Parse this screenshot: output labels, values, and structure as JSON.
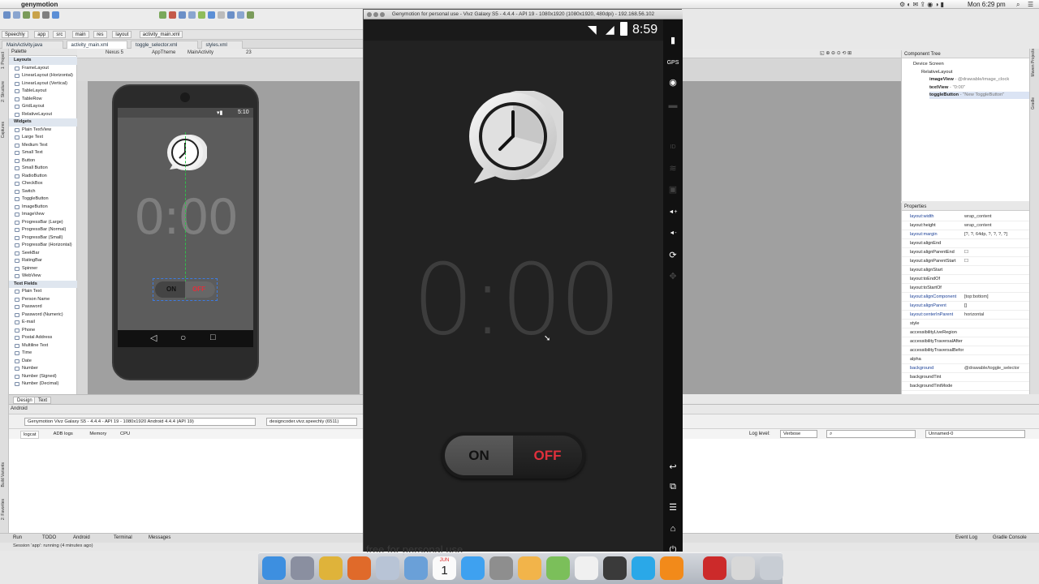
{
  "menubar": {
    "app_name": "genymotion",
    "clock": "Mon 6:29 pm"
  },
  "ide": {
    "crumbs": [
      "Speechly",
      "app",
      "src",
      "main",
      "res",
      "layout",
      "activity_main.xml"
    ],
    "tabs": [
      "MainActivity.java",
      "activity_main.xml",
      "toggle_selector.xml",
      "styles.xml"
    ],
    "design_toolbar": {
      "device": "Nexus 5",
      "theme": "AppTheme",
      "activity": "MainActivity",
      "api": "23"
    },
    "palette_title": "Palette",
    "palette": [
      {
        "type": "grp",
        "label": "Layouts"
      },
      {
        "type": "it",
        "label": "FrameLayout"
      },
      {
        "type": "it",
        "label": "LinearLayout (Horizontal)"
      },
      {
        "type": "it",
        "label": "LinearLayout (Vertical)"
      },
      {
        "type": "it",
        "label": "TableLayout"
      },
      {
        "type": "it",
        "label": "TableRow"
      },
      {
        "type": "it",
        "label": "GridLayout"
      },
      {
        "type": "it",
        "label": "RelativeLayout"
      },
      {
        "type": "grp",
        "label": "Widgets"
      },
      {
        "type": "it",
        "label": "Plain TextView"
      },
      {
        "type": "it",
        "label": "Large Text"
      },
      {
        "type": "it",
        "label": "Medium Text"
      },
      {
        "type": "it",
        "label": "Small Text"
      },
      {
        "type": "it",
        "label": "Button"
      },
      {
        "type": "it",
        "label": "Small Button"
      },
      {
        "type": "it",
        "label": "RadioButton"
      },
      {
        "type": "it",
        "label": "CheckBox"
      },
      {
        "type": "it",
        "label": "Switch"
      },
      {
        "type": "it",
        "label": "ToggleButton"
      },
      {
        "type": "it",
        "label": "ImageButton"
      },
      {
        "type": "it",
        "label": "ImageView"
      },
      {
        "type": "it",
        "label": "ProgressBar (Large)"
      },
      {
        "type": "it",
        "label": "ProgressBar (Normal)"
      },
      {
        "type": "it",
        "label": "ProgressBar (Small)"
      },
      {
        "type": "it",
        "label": "ProgressBar (Horizontal)"
      },
      {
        "type": "it",
        "label": "SeekBar"
      },
      {
        "type": "it",
        "label": "RatingBar"
      },
      {
        "type": "it",
        "label": "Spinner"
      },
      {
        "type": "it",
        "label": "WebView"
      },
      {
        "type": "grp",
        "label": "Text Fields"
      },
      {
        "type": "it",
        "label": "Plain Text"
      },
      {
        "type": "it",
        "label": "Person Name"
      },
      {
        "type": "it",
        "label": "Password"
      },
      {
        "type": "it",
        "label": "Password (Numeric)"
      },
      {
        "type": "it",
        "label": "E-mail"
      },
      {
        "type": "it",
        "label": "Phone"
      },
      {
        "type": "it",
        "label": "Postal Address"
      },
      {
        "type": "it",
        "label": "Multiline Text"
      },
      {
        "type": "it",
        "label": "Time"
      },
      {
        "type": "it",
        "label": "Date"
      },
      {
        "type": "it",
        "label": "Number"
      },
      {
        "type": "it",
        "label": "Number (Signed)"
      },
      {
        "type": "it",
        "label": "Number (Decimal)"
      }
    ],
    "preview": {
      "status_time": "5:10",
      "time": "0:00",
      "on": "ON",
      "off": "OFF"
    },
    "design_tabs": [
      "Design",
      "Text"
    ],
    "android_panel": {
      "title": "Android",
      "device_select": "Genymotion Vivz Galaxy S5 - 4.4.4 - API 19 - 1080x1920 Android 4.4.4 (API 19)",
      "process_select": "designcoder.vivz.speechly (6511)",
      "log_tabs": [
        "logcat",
        "ADB logs",
        "Memory",
        "CPU"
      ],
      "log_level_label": "Log level:",
      "log_level": "Verbose",
      "filter": "Unnamed-0"
    },
    "bottom_tools": [
      "Run",
      "TODO",
      "Android",
      "Terminal",
      "Messages"
    ],
    "bottom_right": [
      "Event Log",
      "Gradle Console"
    ],
    "status": "Session 'app': running (4 minutes ago)",
    "side_labels": {
      "left": [
        "1: Project",
        "2: Structure",
        "Captures",
        "Build Variants",
        "2: Favorites"
      ],
      "right": [
        "Maven Projects",
        "Gradle"
      ]
    },
    "component_tree": {
      "title": "Component Tree",
      "items": [
        {
          "label": "Device Screen",
          "indent": 0
        },
        {
          "label": "RelativeLayout",
          "indent": 1
        },
        {
          "label": "imageView",
          "extra": " - @drawable/image_clock",
          "indent": 2
        },
        {
          "label": "textView",
          "extra": " - \"0:00\"",
          "indent": 2
        },
        {
          "label": "toggleButton",
          "extra": " - \"New ToggleButton\"",
          "indent": 2
        }
      ]
    },
    "properties": {
      "title": "Properties",
      "rows": [
        {
          "k": "layout:width",
          "v": "wrap_content",
          "hl": true
        },
        {
          "k": "layout:height",
          "v": "wrap_content",
          "hl": false
        },
        {
          "k": "layout:margin",
          "v": "[?, ?, 64dp, ?, ?, ?, ?]",
          "hl": true
        },
        {
          "k": "layout:alignEnd",
          "v": "",
          "hl": false
        },
        {
          "k": "layout:alignParentEnd",
          "v": "☐",
          "hl": false
        },
        {
          "k": "layout:alignParentStart",
          "v": "☐",
          "hl": false
        },
        {
          "k": "layout:alignStart",
          "v": "",
          "hl": false
        },
        {
          "k": "layout:toEndOf",
          "v": "",
          "hl": false
        },
        {
          "k": "layout:toStartOf",
          "v": "",
          "hl": false
        },
        {
          "k": "layout:alignComponent",
          "v": "[top:bottom]",
          "hl": true
        },
        {
          "k": "layout:alignParent",
          "v": "[]",
          "hl": true
        },
        {
          "k": "layout:centerInParent",
          "v": "horizontal",
          "hl": true
        },
        {
          "k": "style",
          "v": "",
          "hl": false
        },
        {
          "k": "accessibilityLiveRegion",
          "v": "",
          "hl": false
        },
        {
          "k": "accessibilityTraversalAfter",
          "v": "",
          "hl": false
        },
        {
          "k": "accessibilityTraversalBefore",
          "v": "",
          "hl": false
        },
        {
          "k": "alpha",
          "v": "",
          "hl": false
        },
        {
          "k": "background",
          "v": "@drawable/toggle_selector",
          "hl": true
        },
        {
          "k": "backgroundTint",
          "v": "",
          "hl": false
        },
        {
          "k": "backgroundTintMode",
          "v": "",
          "hl": false
        }
      ]
    }
  },
  "emulator": {
    "title": "Genymotion for personal use - Vivz Galaxy S5 - 4.4.4 - API 19 - 1080x1920 (1080x1920, 480dpi) - 192.168.56.102",
    "clock": "8:59",
    "time": "0:00",
    "toggle_on": "ON",
    "toggle_off": "OFF",
    "watermark": "free for personal use",
    "sidebar_icons": [
      "battery-icon",
      "gps-icon",
      "camera-icon",
      "video-icon",
      "id-icon",
      "network-icon",
      "sms-icon",
      "volume-up-icon",
      "volume-down-icon",
      "rotate-icon",
      "move-icon",
      "back-icon",
      "recent-apps-icon",
      "menu-icon",
      "home-icon",
      "power-icon"
    ]
  },
  "dock": [
    "finder-icon",
    "launchpad-icon",
    "chrome-icon",
    "firefox-icon",
    "launcher-grid-icon",
    "preview-icon",
    "calendar-icon",
    "app-store-icon",
    "system-preferences-icon",
    "photos-icon",
    "android-studio-icon",
    "flickr-icon",
    "photo-booth-icon",
    "skype-icon",
    "vlc-icon",
    "acrobat-icon",
    "messages-icon",
    "trash-icon"
  ],
  "calendar": {
    "month": "JUN",
    "day": "1"
  },
  "colors": {
    "accent_red": "#e0303c",
    "dark_bg": "#222222"
  }
}
